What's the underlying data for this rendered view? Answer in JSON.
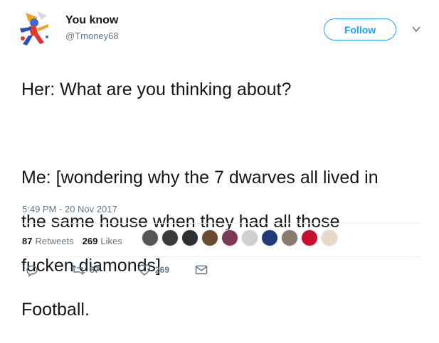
{
  "user": {
    "name": "You know",
    "handle": "@Tmoney68",
    "avatar_icon": "cartoon-character-avatar-icon"
  },
  "follow_label": "Follow",
  "tweet": {
    "lines": [
      "Her: What are you thinking about?",
      "",
      "Me: [wondering why the 7 dwarves all lived in",
      "the same house when they had all those",
      "fucken diamonds]",
      "Football."
    ],
    "timestamp": "5:49 PM - 20 Nov 2017"
  },
  "stats": {
    "retweets_count": "87",
    "retweets_label": "Retweets",
    "likes_count": "269",
    "likes_label": "Likes"
  },
  "likers_colors": [
    "#555555",
    "#3a3a3a",
    "#2f2f2f",
    "#6b4a2f",
    "#7a3b56",
    "#cfcfcf",
    "#1f3a7a",
    "#8a7a6a",
    "#c8102e",
    "#e8d8c8"
  ],
  "actions": {
    "reply_icon": "reply-icon",
    "retweet_icon": "retweet-icon",
    "retweet_count": "87",
    "like_icon": "heart-icon",
    "like_count": "269",
    "dm_icon": "envelope-icon"
  },
  "colors": {
    "accent": "#1da1f2",
    "secondary_text": "#657786",
    "divider": "#e6ecf0"
  }
}
